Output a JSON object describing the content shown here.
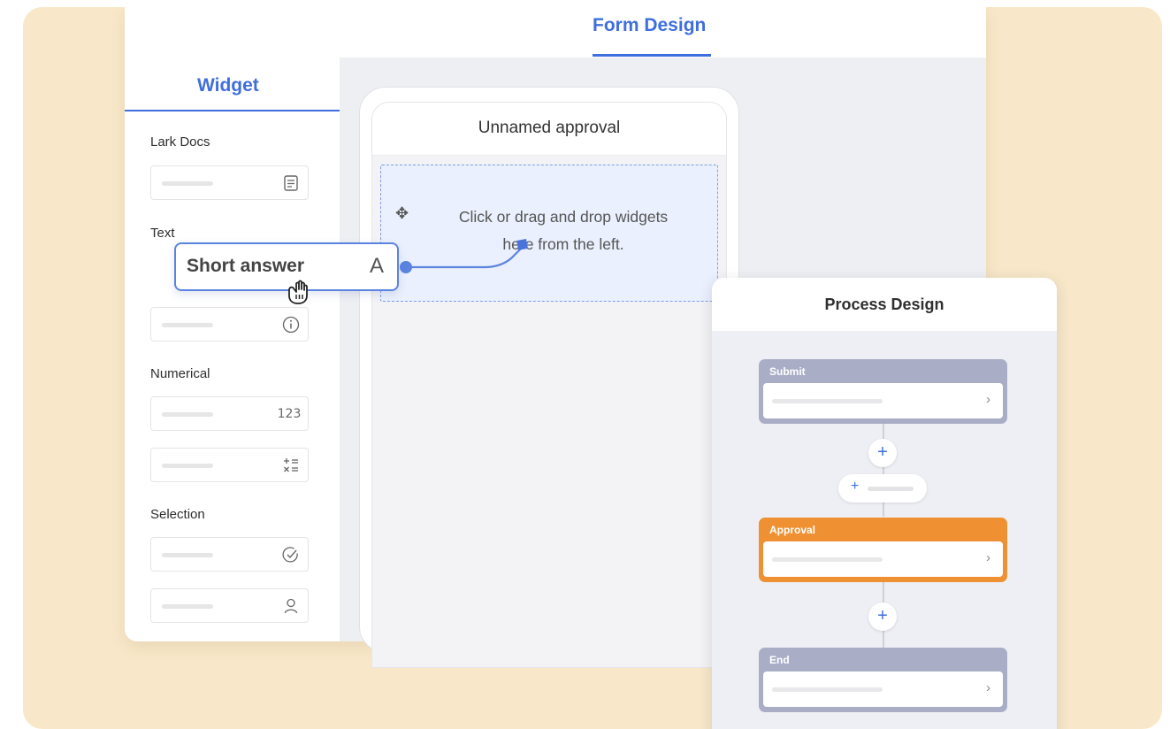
{
  "header": {
    "tab_form_design": "Form Design"
  },
  "sidebar": {
    "tab": "Widget",
    "sections": {
      "lark_docs": "Lark Docs",
      "text": "Text",
      "numerical": "Numerical",
      "selection": "Selection"
    },
    "numeric_icon_text": "123"
  },
  "form": {
    "title": "Unnamed approval",
    "drop_line1": "Click or drag and drop widgets",
    "drop_line2": "here from the left."
  },
  "dragging_widget": {
    "label": "Short answer",
    "icon_glyph": "A"
  },
  "process": {
    "title": "Process Design",
    "nodes": [
      {
        "label": "Submit",
        "color": "#a9aec6"
      },
      {
        "label": "Approval",
        "color": "#ef9133"
      },
      {
        "label": "End",
        "color": "#a9aec6"
      }
    ]
  },
  "colors": {
    "accent": "#3f6fdc",
    "background": "#f8e8c9",
    "approval": "#ef9133"
  },
  "icons": [
    "document-icon",
    "info-icon",
    "number-icon",
    "formula-icon",
    "check-circle-icon",
    "person-icon",
    "move-icon",
    "hand-grab-icon",
    "plus-icon",
    "chevron-right-icon"
  ]
}
